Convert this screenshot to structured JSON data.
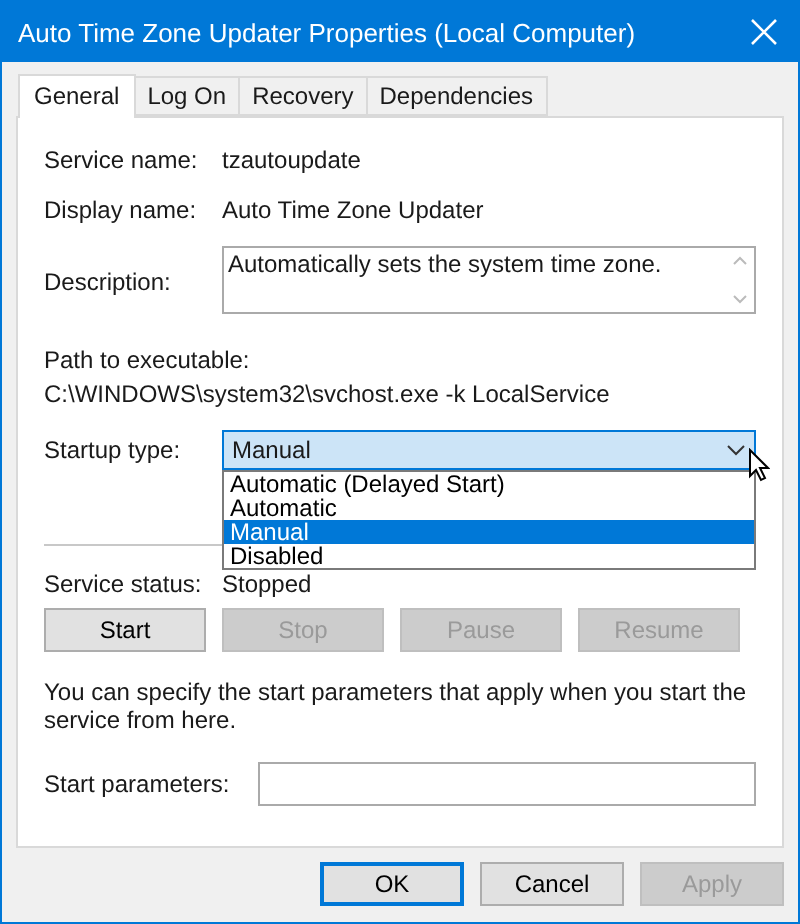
{
  "window": {
    "title": "Auto Time Zone Updater Properties (Local Computer)"
  },
  "tabs": [
    {
      "label": "General",
      "selected": true
    },
    {
      "label": "Log On",
      "selected": false
    },
    {
      "label": "Recovery",
      "selected": false
    },
    {
      "label": "Dependencies",
      "selected": false
    }
  ],
  "fields": [
    {
      "label": "Service name:",
      "value": "tzautoupdate"
    },
    {
      "label": "Display name:",
      "value": "Auto Time Zone Updater"
    }
  ],
  "description": {
    "label": "Description:",
    "value": "Automatically sets the system time zone."
  },
  "path": {
    "label": "Path to executable:",
    "value": "C:\\WINDOWS\\system32\\svchost.exe -k LocalService"
  },
  "startup_type": {
    "label": "Startup type:",
    "value": "Manual",
    "expanded": true,
    "options": [
      {
        "label": "Automatic (Delayed Start)",
        "selected": false
      },
      {
        "label": "Automatic",
        "selected": false
      },
      {
        "label": "Manual",
        "selected": true
      },
      {
        "label": "Disabled",
        "selected": false
      }
    ]
  },
  "service_status": {
    "label": "Service status:",
    "value": "Stopped"
  },
  "service_buttons": [
    {
      "label": "Start",
      "disabled": false
    },
    {
      "label": "Stop",
      "disabled": true
    },
    {
      "label": "Pause",
      "disabled": true
    },
    {
      "label": "Resume",
      "disabled": true
    }
  ],
  "note": "You can specify the start parameters that apply when you start the service from here.",
  "start_parameters": {
    "label": "Start parameters:"
  },
  "dialog_buttons": [
    {
      "label": "OK",
      "default": true,
      "disabled": false
    },
    {
      "label": "Cancel",
      "default": false,
      "disabled": false
    },
    {
      "label": "Apply",
      "default": false,
      "disabled": true
    }
  ]
}
